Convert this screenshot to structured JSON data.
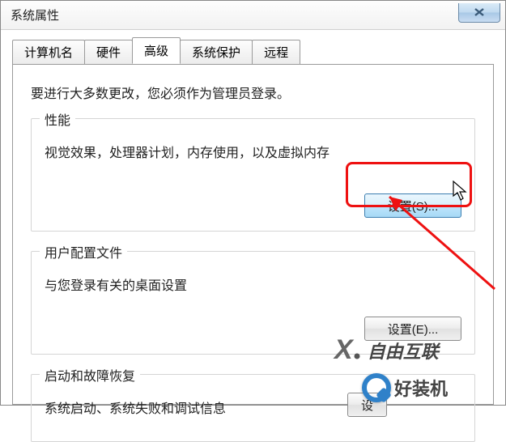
{
  "window": {
    "title": "系统属性"
  },
  "tabs": {
    "t0": "计算机名",
    "t1": "硬件",
    "t2": "高级",
    "t3": "系统保护",
    "t4": "远程"
  },
  "notice": "要进行大多数更改，您必须作为管理员登录。",
  "groups": {
    "performance": {
      "legend": "性能",
      "desc": "视觉效果，处理器计划，内存使用，以及虚拟内存",
      "button": "设置(S)..."
    },
    "userprofile": {
      "legend": "用户配置文件",
      "desc": "与您登录有关的桌面设置",
      "button": "设置(E)..."
    },
    "startup": {
      "legend": "启动和故障恢复",
      "desc": "系统启动、系统失败和调试信息",
      "button": "设"
    }
  },
  "watermarks": {
    "wm1": "自由互联",
    "wm2": "好装机"
  }
}
